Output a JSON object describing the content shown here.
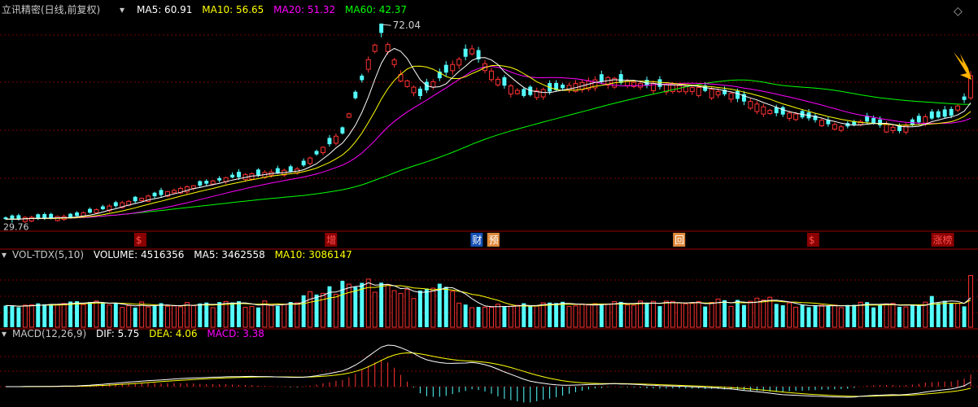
{
  "header_main": {
    "title": "立讯精密(日线,前复权)",
    "items": [
      {
        "label": "MA5: 60.91",
        "color": "#ffffff"
      },
      {
        "label": "MA10: 56.65",
        "color": "#ffff00"
      },
      {
        "label": "MA20: 51.32",
        "color": "#ff00ff"
      },
      {
        "label": "MA60: 42.37",
        "color": "#00ff00"
      }
    ]
  },
  "header_vol": {
    "title": "VOL-TDX(5,10)",
    "items": [
      {
        "label": "VOLUME: 4516356",
        "color": "#ffffff"
      },
      {
        "label": "MA5: 3462558",
        "color": "#ffffff"
      },
      {
        "label": "MA10: 3086147",
        "color": "#ffff00"
      }
    ]
  },
  "header_macd": {
    "title": "MACD(12,26,9)",
    "items": [
      {
        "label": "DIF: 5.75",
        "color": "#ffffff"
      },
      {
        "label": "DEA: 4.06",
        "color": "#ffff00"
      },
      {
        "label": "MACD: 3.38",
        "color": "#ff00ff"
      }
    ]
  },
  "annotations": {
    "high_label": "72.04",
    "low_label": "29.76"
  },
  "event_markers": [
    {
      "label": "$",
      "style": "red",
      "pos": 0.138
    },
    {
      "label": "增",
      "style": "red",
      "pos": 0.333
    },
    {
      "label": "财",
      "style": "blue",
      "pos": 0.482
    },
    {
      "label": "预",
      "style": "orange",
      "pos": 0.499
    },
    {
      "label": "回",
      "style": "orange",
      "pos": 0.689
    },
    {
      "label": "$",
      "style": "red",
      "pos": 0.826
    },
    {
      "label": "涨榜",
      "style": "red",
      "pos": 0.953
    }
  ],
  "colors": {
    "up": "#ff3232",
    "down": "#54ffff",
    "grid": "#7a0000",
    "ma5": "#ffffff",
    "ma10": "#ffff00",
    "ma20": "#ff00ff",
    "ma60": "#00ff00",
    "arrow": "#ffb400"
  },
  "chart_data": {
    "type": "candlestick",
    "series_name": "立讯精密",
    "bars": 150,
    "price_range": [
      29.76,
      72.04
    ],
    "anchors": [
      {
        "i": 0,
        "close": 30.6
      },
      {
        "i": 10,
        "close": 31.0
      },
      {
        "i": 22,
        "close": 35.2
      },
      {
        "i": 35,
        "close": 39.5
      },
      {
        "i": 45,
        "close": 41.0
      },
      {
        "i": 52,
        "close": 49.0
      },
      {
        "i": 56,
        "close": 64.0
      },
      {
        "i": 58,
        "close": 70.5
      },
      {
        "i": 61,
        "close": 61.0
      },
      {
        "i": 64,
        "close": 57.0
      },
      {
        "i": 68,
        "close": 62.0
      },
      {
        "i": 72,
        "close": 66.5
      },
      {
        "i": 76,
        "close": 60.0
      },
      {
        "i": 80,
        "close": 57.0
      },
      {
        "i": 84,
        "close": 58.0
      },
      {
        "i": 88,
        "close": 59.0
      },
      {
        "i": 93,
        "close": 60.3
      },
      {
        "i": 98,
        "close": 59.2
      },
      {
        "i": 103,
        "close": 58.8
      },
      {
        "i": 108,
        "close": 58.0
      },
      {
        "i": 112,
        "close": 57.0
      },
      {
        "i": 118,
        "close": 53.5
      },
      {
        "i": 124,
        "close": 52.2
      },
      {
        "i": 129,
        "close": 50.0
      },
      {
        "i": 133,
        "close": 51.5
      },
      {
        "i": 138,
        "close": 49.5
      },
      {
        "i": 142,
        "close": 52.0
      },
      {
        "i": 146,
        "close": 52.8
      },
      {
        "i": 148,
        "close": 56.0
      },
      {
        "i": 149,
        "close": 61.0
      }
    ],
    "ma_current": {
      "MA5": 60.91,
      "MA10": 56.65,
      "MA20": 51.32,
      "MA60": 42.37
    },
    "volume_current": {
      "VOLUME": 4516356,
      "MA5": 3462558,
      "MA10": 3086147
    },
    "macd_current": {
      "DIF": 5.75,
      "DEA": 4.06,
      "MACD": 3.38
    }
  }
}
